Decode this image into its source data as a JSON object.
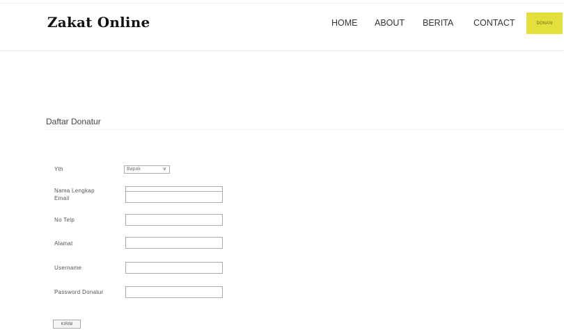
{
  "brand": "Zakat Online",
  "nav": {
    "home": "HOME",
    "about": "ABOUT",
    "berita": "BERITA",
    "contact": "CONTACT",
    "button": "DONASI"
  },
  "accent_color": "#e3df3c",
  "form": {
    "title": "Daftar Donatur",
    "yth_label": "Yth",
    "yth_value": "Bapak",
    "nama_label": "Nama Lengkap",
    "email_label": "Email",
    "telp_label": "No Telp",
    "alamat_label": "Alamat",
    "username_label": "Username",
    "password_label": "Password Donatur",
    "submit_label": "KIRIM"
  }
}
